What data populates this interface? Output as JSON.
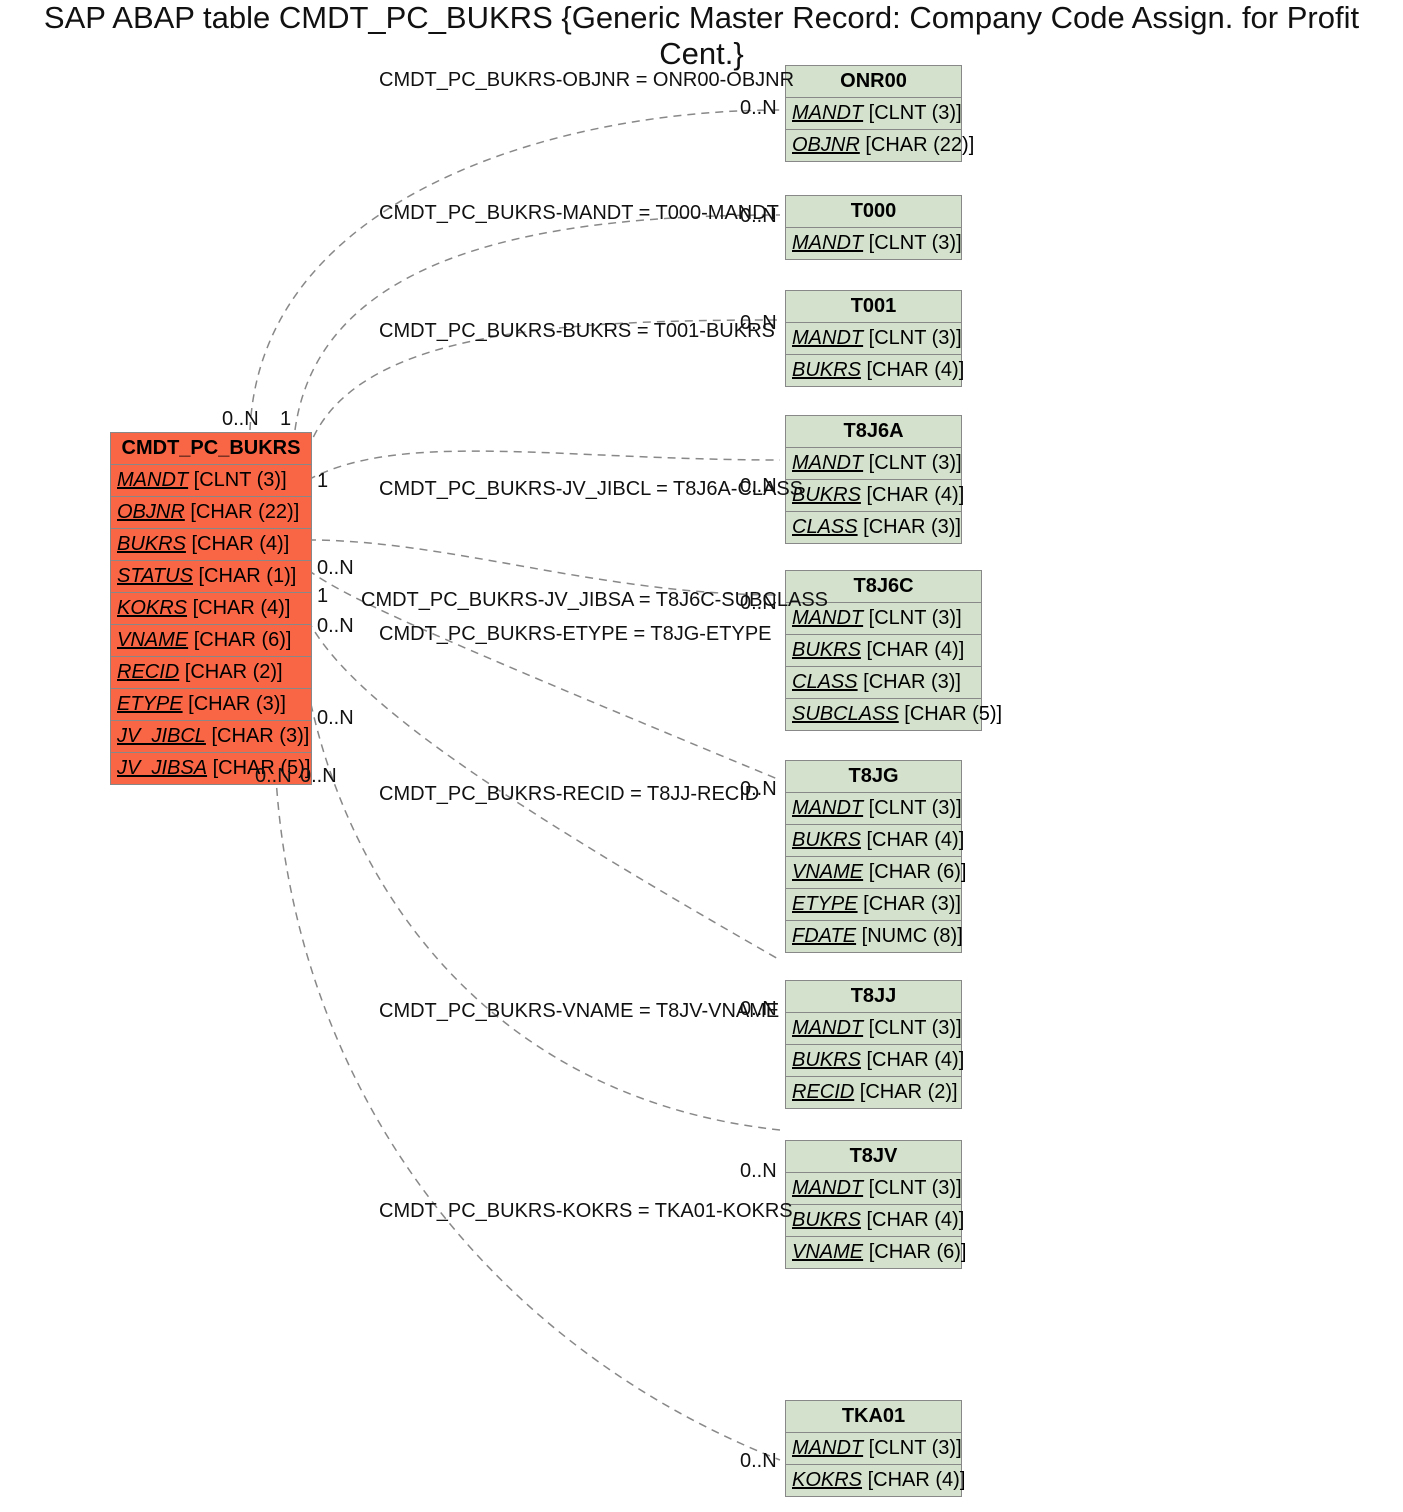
{
  "title": "SAP ABAP table CMDT_PC_BUKRS {Generic Master Record: Company Code Assign. for Profit Cent.}",
  "main_table": {
    "name": "CMDT_PC_BUKRS",
    "fields": [
      {
        "name": "MANDT",
        "type": "[CLNT (3)]"
      },
      {
        "name": "OBJNR",
        "type": "[CHAR (22)]"
      },
      {
        "name": "BUKRS",
        "type": "[CHAR (4)]"
      },
      {
        "name": "STATUS",
        "type": "[CHAR (1)]"
      },
      {
        "name": "KOKRS",
        "type": "[CHAR (4)]"
      },
      {
        "name": "VNAME",
        "type": "[CHAR (6)]"
      },
      {
        "name": "RECID",
        "type": "[CHAR (2)]"
      },
      {
        "name": "ETYPE",
        "type": "[CHAR (3)]"
      },
      {
        "name": "JV_JIBCL",
        "type": "[CHAR (3)]"
      },
      {
        "name": "JV_JIBSA",
        "type": "[CHAR (5)]"
      }
    ]
  },
  "related_tables": [
    {
      "name": "ONR00",
      "fields": [
        {
          "name": "MANDT",
          "type": "[CLNT (3)]"
        },
        {
          "name": "OBJNR",
          "type": "[CHAR (22)]"
        }
      ]
    },
    {
      "name": "T000",
      "fields": [
        {
          "name": "MANDT",
          "type": "[CLNT (3)]"
        }
      ]
    },
    {
      "name": "T001",
      "fields": [
        {
          "name": "MANDT",
          "type": "[CLNT (3)]"
        },
        {
          "name": "BUKRS",
          "type": "[CHAR (4)]"
        }
      ]
    },
    {
      "name": "T8J6A",
      "fields": [
        {
          "name": "MANDT",
          "type": "[CLNT (3)]"
        },
        {
          "name": "BUKRS",
          "type": "[CHAR (4)]"
        },
        {
          "name": "CLASS",
          "type": "[CHAR (3)]"
        }
      ]
    },
    {
      "name": "T8J6C",
      "fields": [
        {
          "name": "MANDT",
          "type": "[CLNT (3)]"
        },
        {
          "name": "BUKRS",
          "type": "[CHAR (4)]"
        },
        {
          "name": "CLASS",
          "type": "[CHAR (3)]"
        },
        {
          "name": "SUBCLASS",
          "type": "[CHAR (5)]"
        }
      ]
    },
    {
      "name": "T8JG",
      "fields": [
        {
          "name": "MANDT",
          "type": "[CLNT (3)]"
        },
        {
          "name": "BUKRS",
          "type": "[CHAR (4)]"
        },
        {
          "name": "VNAME",
          "type": "[CHAR (6)]"
        },
        {
          "name": "ETYPE",
          "type": "[CHAR (3)]"
        },
        {
          "name": "FDATE",
          "type": "[NUMC (8)]"
        }
      ]
    },
    {
      "name": "T8JJ",
      "fields": [
        {
          "name": "MANDT",
          "type": "[CLNT (3)]"
        },
        {
          "name": "BUKRS",
          "type": "[CHAR (4)]"
        },
        {
          "name": "RECID",
          "type": "[CHAR (2)]"
        }
      ]
    },
    {
      "name": "T8JV",
      "fields": [
        {
          "name": "MANDT",
          "type": "[CLNT (3)]"
        },
        {
          "name": "BUKRS",
          "type": "[CHAR (4)]"
        },
        {
          "name": "VNAME",
          "type": "[CHAR (6)]"
        }
      ]
    },
    {
      "name": "TKA01",
      "fields": [
        {
          "name": "MANDT",
          "type": "[CLNT (3)]"
        },
        {
          "name": "KOKRS",
          "type": "[CHAR (4)]"
        }
      ]
    }
  ],
  "associations": [
    {
      "label": "CMDT_PC_BUKRS-OBJNR = ONR00-OBJNR"
    },
    {
      "label": "CMDT_PC_BUKRS-MANDT = T000-MANDT"
    },
    {
      "label": "CMDT_PC_BUKRS-BUKRS = T001-BUKRS"
    },
    {
      "label": "CMDT_PC_BUKRS-JV_JIBCL = T8J6A-CLASS"
    },
    {
      "label": "CMDT_PC_BUKRS-JV_JIBSA = T8J6C-SUBCLASS"
    },
    {
      "label": "CMDT_PC_BUKRS-ETYPE = T8JG-ETYPE"
    },
    {
      "label": "CMDT_PC_BUKRS-RECID = T8JJ-RECID"
    },
    {
      "label": "CMDT_PC_BUKRS-VNAME = T8JV-VNAME"
    },
    {
      "label": "CMDT_PC_BUKRS-KOKRS = TKA01-KOKRS"
    }
  ],
  "cardinalities": {
    "main_side": [
      "0..N",
      "1",
      "1",
      "0..N",
      "1",
      "0..N",
      "0..N",
      "0..N",
      "0..N"
    ],
    "far_side": [
      "0..N",
      "0..N",
      "0..N",
      "0..N",
      "0..N",
      "0..N",
      "0..N",
      "0..N",
      "0..N"
    ]
  }
}
